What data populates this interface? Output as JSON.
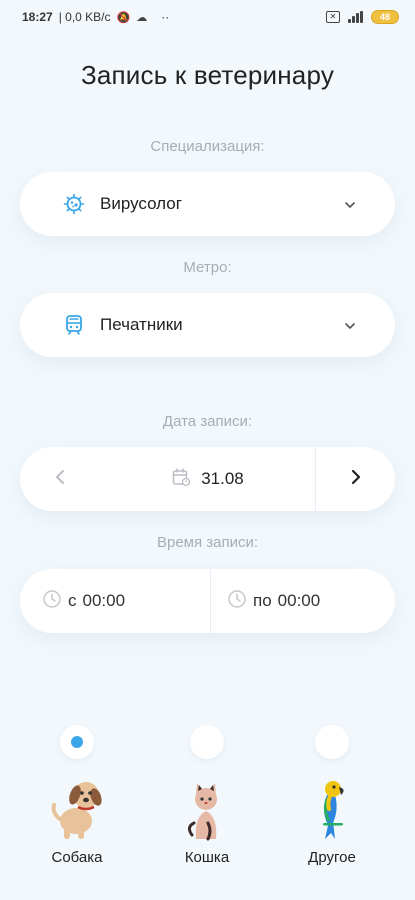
{
  "status_bar": {
    "time": "18:27",
    "net": "| 0,0 KB/c",
    "more": "··",
    "battery": "48"
  },
  "page": {
    "title": "Запись к ветеринару"
  },
  "specialization": {
    "label": "Специализация:",
    "value": "Вирусолог"
  },
  "metro": {
    "label": "Метро:",
    "value": "Печатники"
  },
  "date": {
    "label": "Дата записи:",
    "value": "31.08"
  },
  "time": {
    "label": "Время записи:",
    "from_prefix": "с",
    "from_value": "00:00",
    "to_prefix": "по",
    "to_value": "00:00"
  },
  "pets": [
    {
      "name": "Собака",
      "selected": true
    },
    {
      "name": "Кошка",
      "selected": false
    },
    {
      "name": "Другое",
      "selected": false
    }
  ],
  "colors": {
    "accent": "#3aa6e8",
    "background": "#f2f8fc",
    "label": "#a8adb3"
  },
  "icons": {
    "specialization": "virus-icon",
    "metro": "metro-train-icon",
    "date": "calendar-icon",
    "time": "clock-icon"
  }
}
